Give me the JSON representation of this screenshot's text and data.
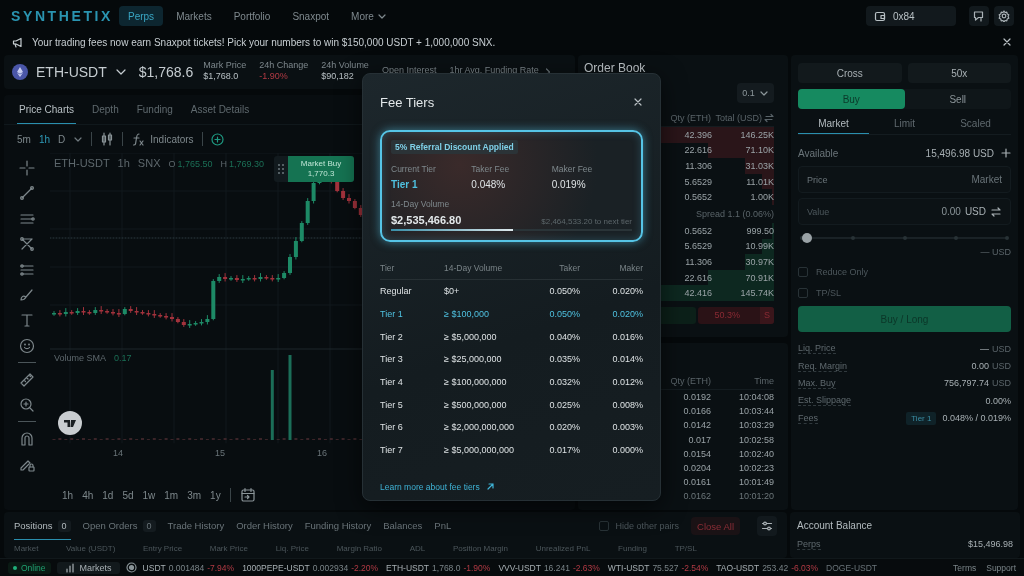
{
  "nav": {
    "logo": "SYNTHETIX",
    "items": [
      {
        "label": "Perps",
        "selected": true,
        "kind": "link"
      },
      {
        "label": "Markets",
        "selected": false,
        "kind": "link"
      },
      {
        "label": "Portfolio",
        "selected": false,
        "kind": "link"
      },
      {
        "label": "Snaxpot",
        "selected": false,
        "kind": "link"
      },
      {
        "label": "More",
        "selected": false,
        "kind": "menu"
      }
    ],
    "wallet": "0x84"
  },
  "announcement": {
    "text": "Your trading fees now earn Snaxpot tickets! Pick your numbers to win $150,000 USDT + 1,000,000 SNX."
  },
  "market": {
    "symbol": "ETH-USDT",
    "price": "$1,768.6",
    "stats": [
      {
        "label": "Mark Price",
        "value": "$1,768.0"
      },
      {
        "label": "24h Change",
        "value": "-1.90%"
      },
      {
        "label": "24h Volume",
        "value": "$90,182"
      },
      {
        "label": "Open Interest"
      },
      {
        "label": "1hr Avg. Funding Rate"
      }
    ]
  },
  "chart_panel": {
    "tabs": [
      {
        "label": "Price Charts",
        "selected": true
      },
      {
        "label": "Depth",
        "selected": false
      },
      {
        "label": "Funding",
        "selected": false
      },
      {
        "label": "Asset Details",
        "selected": false
      }
    ],
    "intervals": [
      {
        "label": "5m",
        "selected": false
      },
      {
        "label": "1h",
        "selected": true
      },
      {
        "label": "D",
        "selected": false
      }
    ],
    "indicators": "Indicators",
    "legend": {
      "symbol": "ETH-USDT",
      "interval": "1h",
      "source": "SNX",
      "open_key": "O",
      "open": "1,765.50",
      "high_key": "H",
      "high": "1,769.30"
    },
    "market_buy": {
      "label": "Market Buy",
      "price": "1,770.3"
    },
    "volume_label": "Volume SMA",
    "volume_value": "0.17",
    "x_labels": [
      "14",
      "15",
      "16"
    ],
    "ranges": [
      "1h",
      "4h",
      "1d",
      "5d",
      "1w",
      "1m",
      "3m",
      "1y"
    ]
  },
  "order_book": {
    "title": "Order Book",
    "step": "0.1",
    "columns": [
      "Qty (ETH)",
      "Total (USD)"
    ],
    "asks": [
      {
        "qty": "42.396",
        "total": "146.25K"
      },
      {
        "qty": "22.616",
        "total": "71.10K"
      },
      {
        "qty": "11.306",
        "total": "31.03K"
      },
      {
        "qty": "5.6529",
        "total": "11.01K"
      },
      {
        "qty": "0.5652",
        "total": "1.00K"
      }
    ],
    "spread": "Spread 1.1 (0.06%)",
    "bids": [
      {
        "qty": "0.5652",
        "total": "999.50"
      },
      {
        "qty": "5.6529",
        "total": "10.99K"
      },
      {
        "qty": "11.306",
        "total": "30.97K"
      },
      {
        "qty": "22.616",
        "total": "70.91K"
      },
      {
        "qty": "42.416",
        "total": "145.74K"
      }
    ],
    "sell_share": "50.3%",
    "sell_key": "S"
  },
  "trades": {
    "columns": [
      "Qty (ETH)",
      "Time"
    ],
    "rows": [
      {
        "qty": "0.0192",
        "time": "10:04:08"
      },
      {
        "qty": "0.0166",
        "time": "10:03:44"
      },
      {
        "qty": "0.0142",
        "time": "10:03:29"
      },
      {
        "qty": "0.017",
        "time": "10:02:58"
      },
      {
        "qty": "0.0154",
        "time": "10:02:40"
      },
      {
        "qty": "0.0204",
        "time": "10:02:23"
      },
      {
        "qty": "0.0161",
        "time": "10:01:49"
      },
      {
        "qty": "0.0162",
        "time": "10:01:20"
      }
    ]
  },
  "order_form": {
    "margin_mode": "Cross",
    "leverage": "50x",
    "sides": [
      {
        "label": "Buy",
        "selected": true
      },
      {
        "label": "Sell",
        "selected": false
      }
    ],
    "order_types": [
      {
        "label": "Market",
        "selected": true
      },
      {
        "label": "Limit",
        "selected": false
      },
      {
        "label": "Scaled",
        "selected": false
      }
    ],
    "available_label": "Available",
    "available": "15,496.98 USD",
    "price_field": {
      "label": "Price",
      "value": "Market",
      "disabled": true
    },
    "value_field": {
      "label": "Value",
      "value": "0.00",
      "unit": "USD"
    },
    "slider": {
      "level": 0
    },
    "size_readout": "— USD",
    "options": [
      {
        "label": "Reduce Only",
        "checked": false
      },
      {
        "label": "TP/SL",
        "checked": false
      }
    ],
    "submit": "Buy / Long",
    "details": [
      {
        "label": "Liq. Price",
        "value": "—",
        "unit": "USD"
      },
      {
        "label": "Req. Margin",
        "value": "0.00",
        "unit": "USD"
      },
      {
        "label": "Max. Buy",
        "value": "756,797.74",
        "unit": "USD"
      },
      {
        "label": "Est. Slippage",
        "value": "0.00%"
      },
      {
        "label": "Fees",
        "badge": "Tier 1",
        "value": "0.048% / 0.019%"
      }
    ]
  },
  "bottom": {
    "tabs": [
      {
        "label": "Positions",
        "count": "0",
        "selected": true
      },
      {
        "label": "Open Orders",
        "count": "0",
        "selected": false
      },
      {
        "label": "Trade History",
        "selected": false
      },
      {
        "label": "Order History",
        "selected": false
      },
      {
        "label": "Funding History",
        "selected": false
      },
      {
        "label": "Balances",
        "selected": false
      },
      {
        "label": "PnL",
        "selected": false
      }
    ],
    "hide_other_pairs": {
      "label": "Hide other pairs",
      "checked": false
    },
    "close_all": "Close All",
    "columns": [
      "Market",
      "Value (USDT)",
      "Entry Price",
      "Mark Price",
      "Liq. Price",
      "Margin Ratio",
      "ADL",
      "Position Margin",
      "Unrealized PnL",
      "Funding",
      "TP/SL"
    ]
  },
  "account": {
    "title": "Account Balance",
    "rows": [
      {
        "label": "Perps",
        "value": "$15,496.98"
      }
    ]
  },
  "status_bar": {
    "connection": {
      "label": "Online"
    },
    "markets": "Markets",
    "tickers": [
      {
        "symbol": "USDT",
        "price": "0.001484",
        "change": "-7.94%"
      },
      {
        "symbol": "1000PEPE-USDT",
        "price": "0.002934",
        "change": "-2.20%"
      },
      {
        "symbol": "ETH-USDT",
        "price": "1,768.0",
        "change": "-1.90%"
      },
      {
        "symbol": "VVV-USDT",
        "price": "16.241",
        "change": "-2.63%"
      },
      {
        "symbol": "WTI-USDT",
        "price": "75.527",
        "change": "-2.54%"
      },
      {
        "symbol": "TAO-USDT",
        "price": "253.42",
        "change": "-6.03%"
      },
      {
        "symbol": "DOGE-USDT"
      }
    ],
    "links": [
      "Terms",
      "Support"
    ]
  },
  "fee_modal": {
    "title": "Fee Tiers",
    "discount": "5% Referral Discount Applied",
    "summary": [
      {
        "label": "Current Tier",
        "value": "Tier 1",
        "kind": "tier"
      },
      {
        "label": "Taker Fee",
        "value": "0.048%",
        "kind": "fee"
      },
      {
        "label": "Maker Fee",
        "value": "0.019%",
        "kind": "fee"
      }
    ],
    "volume_label": "14-Day Volume",
    "volume": "$2,535,466.80",
    "to_next": "$2,464,533.20 to next tier",
    "level": 0.507,
    "columns": [
      "Tier",
      "14-Day Volume",
      "Taker",
      "Maker"
    ],
    "rows": [
      {
        "tier": "Regular",
        "volume": "$0+",
        "taker": "0.050%",
        "maker": "0.020%",
        "selected": false
      },
      {
        "tier": "Tier 1",
        "volume": "≥ $100,000",
        "taker": "0.050%",
        "maker": "0.020%",
        "selected": true
      },
      {
        "tier": "Tier 2",
        "volume": "≥ $5,000,000",
        "taker": "0.040%",
        "maker": "0.016%",
        "selected": false
      },
      {
        "tier": "Tier 3",
        "volume": "≥ $25,000,000",
        "taker": "0.035%",
        "maker": "0.014%",
        "selected": false
      },
      {
        "tier": "Tier 4",
        "volume": "≥ $100,000,000",
        "taker": "0.032%",
        "maker": "0.012%",
        "selected": false
      },
      {
        "tier": "Tier 5",
        "volume": "≥ $500,000,000",
        "taker": "0.025%",
        "maker": "0.008%",
        "selected": false
      },
      {
        "tier": "Tier 6",
        "volume": "≥ $2,000,000,000",
        "taker": "0.020%",
        "maker": "0.003%",
        "selected": false
      },
      {
        "tier": "Tier 7",
        "volume": "≥ $5,000,000,000",
        "taker": "0.017%",
        "maker": "0.000%",
        "selected": false
      }
    ],
    "link": "Learn more about fee tiers"
  }
}
